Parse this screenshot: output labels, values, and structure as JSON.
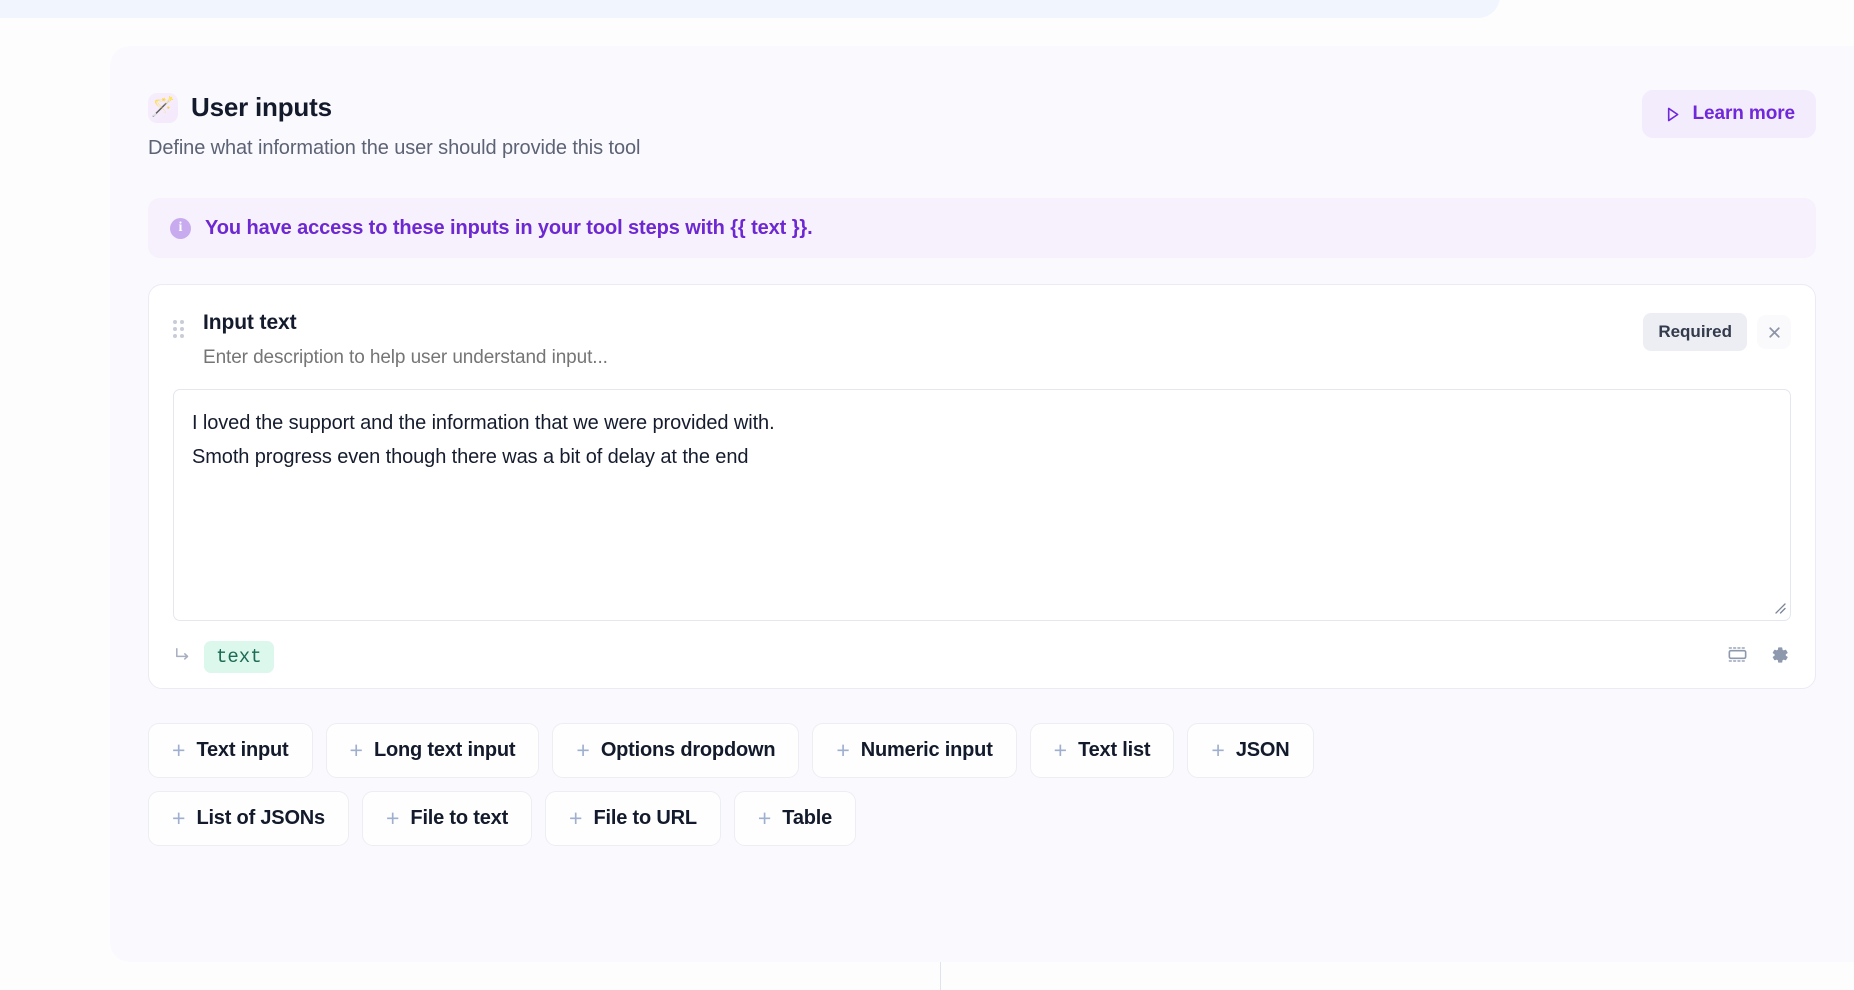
{
  "panel": {
    "icon": "magic-wand-icon",
    "icon_glyph": "🪄",
    "title": "User inputs",
    "subtitle": "Define what information the user should provide this tool",
    "learn_more_label": "Learn more",
    "learn_more_icon": "play-icon"
  },
  "info_banner": {
    "icon": "info-icon",
    "text": "You have access to these inputs in your tool steps with {{ text }}."
  },
  "input_card": {
    "drag_handle_icon": "drag-handle-icon",
    "title": "Input text",
    "description_placeholder": "Enter description to help user understand input...",
    "description_value": "",
    "required_label": "Required",
    "close_icon": "close-icon",
    "value": "I loved the support and the information that we were provided with.\nSmoth progress even though there was a bit of delay at the end",
    "value_placeholder": "",
    "variable_arrow_icon": "corner-down-right-icon",
    "variable_name": "text",
    "footer_icons": [
      {
        "name": "form-input-icon"
      },
      {
        "name": "gear-icon"
      }
    ]
  },
  "add_buttons": {
    "rows": [
      [
        {
          "label": "Text input"
        },
        {
          "label": "Long text input"
        },
        {
          "label": "Options dropdown"
        },
        {
          "label": "Numeric input"
        },
        {
          "label": "Text list"
        },
        {
          "label": "JSON"
        }
      ],
      [
        {
          "label": "List of JSONs"
        },
        {
          "label": "File to text"
        },
        {
          "label": "File to URL"
        },
        {
          "label": "Table"
        }
      ]
    ],
    "plus_glyph": "+"
  },
  "colors": {
    "accent_purple": "#6d28d2",
    "panel_background": "#faf9fe",
    "banner_background": "#f6f1fd",
    "chip_green_bg": "#dcf7ec",
    "chip_green_text": "#1c6b55",
    "required_badge_bg": "#eceef3"
  }
}
